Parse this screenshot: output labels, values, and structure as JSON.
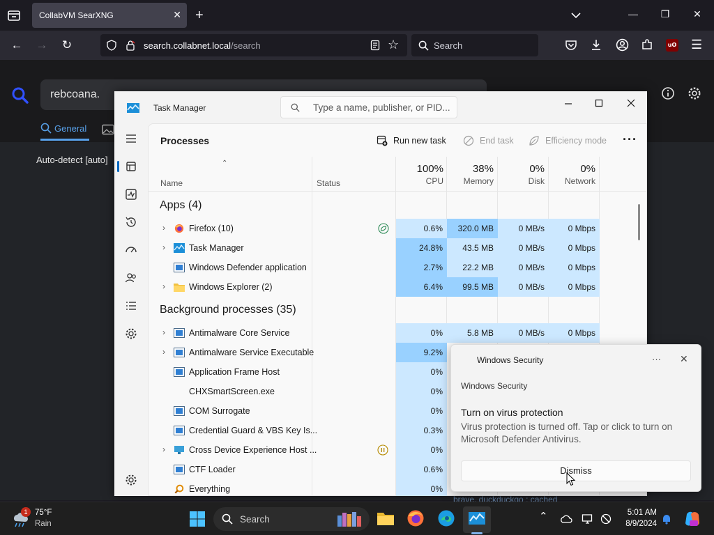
{
  "browser": {
    "tab_title": "CollabVM SearXNG",
    "url_host": "search.collabnet.local",
    "url_path": "/search",
    "search_placeholder": "Search"
  },
  "searxng": {
    "query": "rebcoana.",
    "tabs": [
      "General"
    ],
    "language": "Auto-detect [auto]",
    "hidden_text": "brave, duckduckgo : cached"
  },
  "task_manager": {
    "title": "Task Manager",
    "search_placeholder": "Type a name, publisher, or PID...",
    "heading": "Processes",
    "actions": {
      "run_new_task": "Run new task",
      "end_task": "End task",
      "efficiency_mode": "Efficiency mode"
    },
    "columns": {
      "name": "Name",
      "status": "Status",
      "cpu_pct": "100%",
      "cpu": "CPU",
      "mem_pct": "38%",
      "mem": "Memory",
      "disk_pct": "0%",
      "disk": "Disk",
      "net_pct": "0%",
      "net": "Network"
    },
    "group_apps": "Apps (4)",
    "group_bg": "Background processes (35)",
    "apps": [
      {
        "name": "Firefox (10)",
        "cpu": "0.6%",
        "mem": "320.0 MB",
        "disk": "0 MB/s",
        "net": "0 Mbps"
      },
      {
        "name": "Task Manager",
        "cpu": "24.8%",
        "mem": "43.5 MB",
        "disk": "0 MB/s",
        "net": "0 Mbps"
      },
      {
        "name": "Windows Defender application",
        "cpu": "2.7%",
        "mem": "22.2 MB",
        "disk": "0 MB/s",
        "net": "0 Mbps"
      },
      {
        "name": "Windows Explorer (2)",
        "cpu": "6.4%",
        "mem": "99.5 MB",
        "disk": "0 MB/s",
        "net": "0 Mbps"
      }
    ],
    "background": [
      {
        "name": "Antimalware Core Service",
        "cpu": "0%",
        "mem": "5.8 MB",
        "disk": "0 MB/s",
        "net": "0 Mbps"
      },
      {
        "name": "Antimalware Service Executable",
        "cpu": "9.2%"
      },
      {
        "name": "Application Frame Host",
        "cpu": "0%"
      },
      {
        "name": "CHXSmartScreen.exe",
        "cpu": "0%"
      },
      {
        "name": "COM Surrogate",
        "cpu": "0%"
      },
      {
        "name": "Credential Guard & VBS Key Is...",
        "cpu": "0.3%"
      },
      {
        "name": "Cross Device Experience Host ...",
        "cpu": "0%"
      },
      {
        "name": "CTF Loader",
        "cpu": "0.6%"
      },
      {
        "name": "Everything",
        "cpu": "0%"
      }
    ]
  },
  "toast": {
    "app": "Windows Security",
    "source": "Windows Security",
    "headline": "Turn on virus protection",
    "body": "Virus protection is turned off. Tap or click to turn on Microsoft Defender Antivirus.",
    "button": "Dismiss",
    "more": "···"
  },
  "taskbar": {
    "weather_badge": "1",
    "weather_temp": "75°F",
    "weather_desc": "Rain",
    "search_placeholder": "Search",
    "time": "5:01 AM",
    "date": "8/9/2024"
  },
  "colors": {
    "accent": "#0067c0",
    "heat_light": "#cce8ff",
    "heat_mid": "#99d1ff",
    "searx_blue": "#58a0e8"
  }
}
